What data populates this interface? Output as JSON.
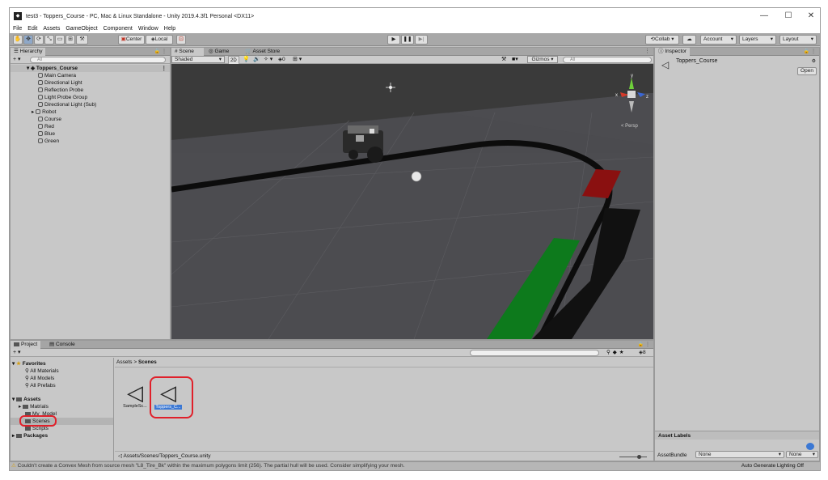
{
  "window": {
    "title": "test3 - Toppers_Course - PC, Mac & Linux Standalone - Unity 2019.4.3f1 Personal <DX11>",
    "app_icon": "unity-logo",
    "controls": [
      "—",
      "☐",
      "✕"
    ]
  },
  "menu": [
    "File",
    "Edit",
    "Assets",
    "GameObject",
    "Component",
    "Window",
    "Help"
  ],
  "toolbar": {
    "tools": [
      "hand-tool-icon",
      "move-tool-icon",
      "rotate-tool-icon",
      "scale-tool-icon",
      "rect-tool-icon",
      "transform-tool-icon",
      "custom-tool-icon"
    ],
    "center_label": "Center",
    "local_label": "Local",
    "collab_label": "Collab ▾",
    "account_label": "Account",
    "layers_label": "Layers",
    "layout_label": "Layout"
  },
  "hierarchy": {
    "tab": "Hierarchy",
    "add": "+ ▾",
    "search_placeholder": "All",
    "scene_name": "Toppers_Course",
    "items": [
      "Main Camera",
      "Directional Light",
      "Reflection Probe",
      "Light Probe Group",
      "Directional Light (Sub)",
      "Robot",
      "Course",
      "Red",
      "Blue",
      "Green"
    ]
  },
  "scene_view": {
    "tabs": [
      "Scene",
      "Game",
      "Asset Store"
    ],
    "shading": "Shaded",
    "mode_2d": "2D",
    "gizmos": "Gizmos",
    "search_placeholder": "All",
    "fx_count": "0",
    "persp": "< Persp",
    "axes": {
      "x": "x",
      "y": "y",
      "z": "z"
    },
    "colors": {
      "track": "#0c0c0c",
      "green_zone": "#0d7a1c",
      "red_zone": "#8a1010",
      "floor": "#4e4e52",
      "sky": "#3a3a3a"
    }
  },
  "inspector": {
    "tab": "Inspector",
    "asset_name": "Toppers_Course",
    "open_label": "Open",
    "asset_labels": "Asset Labels",
    "asset_bundle_label": "AssetBundle",
    "bundle_value": "None",
    "variant_value": "None"
  },
  "project": {
    "tabs": [
      "Project",
      "Console"
    ],
    "add": "+ ▾",
    "hidden_count": "8",
    "favorites_label": "Favorites",
    "favorites": [
      "All Materials",
      "All Models",
      "All Prefabs"
    ],
    "assets_label": "Assets",
    "asset_folders": [
      "Matrials",
      "My_Model",
      "Scenes",
      "Scripts"
    ],
    "packages_label": "Packages",
    "breadcrumb": [
      "Assets",
      "Scenes"
    ],
    "files": [
      {
        "name": "SampleSc...",
        "selected": false
      },
      {
        "name": "Toppers_C...",
        "selected": true
      }
    ],
    "path": "Assets/Scenes/Toppers_Course.unity"
  },
  "status": {
    "warning": "Couldn't create a Convex Mesh from source mesh \"L8_Tire_Bk\" within the maximum polygons limit (256). The partial hull will be used. Consider simplifying your mesh.",
    "right": "Auto Generate Lighting Off"
  },
  "highlight_color": "#e0202a",
  "accent": "#3b78d4"
}
